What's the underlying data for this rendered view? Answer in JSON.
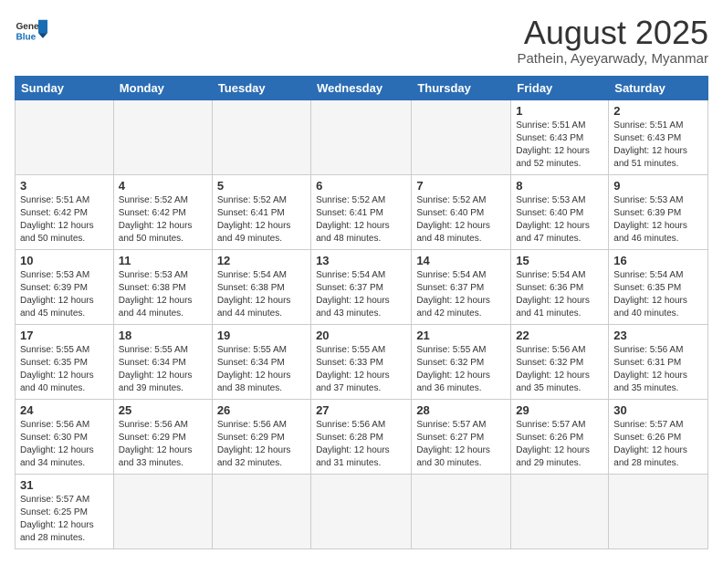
{
  "logo": {
    "text_general": "General",
    "text_blue": "Blue"
  },
  "title": "August 2025",
  "subtitle": "Pathein, Ayeyarwady, Myanmar",
  "weekdays": [
    "Sunday",
    "Monday",
    "Tuesday",
    "Wednesday",
    "Thursday",
    "Friday",
    "Saturday"
  ],
  "weeks": [
    [
      {
        "day": "",
        "info": ""
      },
      {
        "day": "",
        "info": ""
      },
      {
        "day": "",
        "info": ""
      },
      {
        "day": "",
        "info": ""
      },
      {
        "day": "",
        "info": ""
      },
      {
        "day": "1",
        "info": "Sunrise: 5:51 AM\nSunset: 6:43 PM\nDaylight: 12 hours and 52 minutes."
      },
      {
        "day": "2",
        "info": "Sunrise: 5:51 AM\nSunset: 6:43 PM\nDaylight: 12 hours and 51 minutes."
      }
    ],
    [
      {
        "day": "3",
        "info": "Sunrise: 5:51 AM\nSunset: 6:42 PM\nDaylight: 12 hours and 50 minutes."
      },
      {
        "day": "4",
        "info": "Sunrise: 5:52 AM\nSunset: 6:42 PM\nDaylight: 12 hours and 50 minutes."
      },
      {
        "day": "5",
        "info": "Sunrise: 5:52 AM\nSunset: 6:41 PM\nDaylight: 12 hours and 49 minutes."
      },
      {
        "day": "6",
        "info": "Sunrise: 5:52 AM\nSunset: 6:41 PM\nDaylight: 12 hours and 48 minutes."
      },
      {
        "day": "7",
        "info": "Sunrise: 5:52 AM\nSunset: 6:40 PM\nDaylight: 12 hours and 48 minutes."
      },
      {
        "day": "8",
        "info": "Sunrise: 5:53 AM\nSunset: 6:40 PM\nDaylight: 12 hours and 47 minutes."
      },
      {
        "day": "9",
        "info": "Sunrise: 5:53 AM\nSunset: 6:39 PM\nDaylight: 12 hours and 46 minutes."
      }
    ],
    [
      {
        "day": "10",
        "info": "Sunrise: 5:53 AM\nSunset: 6:39 PM\nDaylight: 12 hours and 45 minutes."
      },
      {
        "day": "11",
        "info": "Sunrise: 5:53 AM\nSunset: 6:38 PM\nDaylight: 12 hours and 44 minutes."
      },
      {
        "day": "12",
        "info": "Sunrise: 5:54 AM\nSunset: 6:38 PM\nDaylight: 12 hours and 44 minutes."
      },
      {
        "day": "13",
        "info": "Sunrise: 5:54 AM\nSunset: 6:37 PM\nDaylight: 12 hours and 43 minutes."
      },
      {
        "day": "14",
        "info": "Sunrise: 5:54 AM\nSunset: 6:37 PM\nDaylight: 12 hours and 42 minutes."
      },
      {
        "day": "15",
        "info": "Sunrise: 5:54 AM\nSunset: 6:36 PM\nDaylight: 12 hours and 41 minutes."
      },
      {
        "day": "16",
        "info": "Sunrise: 5:54 AM\nSunset: 6:35 PM\nDaylight: 12 hours and 40 minutes."
      }
    ],
    [
      {
        "day": "17",
        "info": "Sunrise: 5:55 AM\nSunset: 6:35 PM\nDaylight: 12 hours and 40 minutes."
      },
      {
        "day": "18",
        "info": "Sunrise: 5:55 AM\nSunset: 6:34 PM\nDaylight: 12 hours and 39 minutes."
      },
      {
        "day": "19",
        "info": "Sunrise: 5:55 AM\nSunset: 6:34 PM\nDaylight: 12 hours and 38 minutes."
      },
      {
        "day": "20",
        "info": "Sunrise: 5:55 AM\nSunset: 6:33 PM\nDaylight: 12 hours and 37 minutes."
      },
      {
        "day": "21",
        "info": "Sunrise: 5:55 AM\nSunset: 6:32 PM\nDaylight: 12 hours and 36 minutes."
      },
      {
        "day": "22",
        "info": "Sunrise: 5:56 AM\nSunset: 6:32 PM\nDaylight: 12 hours and 35 minutes."
      },
      {
        "day": "23",
        "info": "Sunrise: 5:56 AM\nSunset: 6:31 PM\nDaylight: 12 hours and 35 minutes."
      }
    ],
    [
      {
        "day": "24",
        "info": "Sunrise: 5:56 AM\nSunset: 6:30 PM\nDaylight: 12 hours and 34 minutes."
      },
      {
        "day": "25",
        "info": "Sunrise: 5:56 AM\nSunset: 6:29 PM\nDaylight: 12 hours and 33 minutes."
      },
      {
        "day": "26",
        "info": "Sunrise: 5:56 AM\nSunset: 6:29 PM\nDaylight: 12 hours and 32 minutes."
      },
      {
        "day": "27",
        "info": "Sunrise: 5:56 AM\nSunset: 6:28 PM\nDaylight: 12 hours and 31 minutes."
      },
      {
        "day": "28",
        "info": "Sunrise: 5:57 AM\nSunset: 6:27 PM\nDaylight: 12 hours and 30 minutes."
      },
      {
        "day": "29",
        "info": "Sunrise: 5:57 AM\nSunset: 6:26 PM\nDaylight: 12 hours and 29 minutes."
      },
      {
        "day": "30",
        "info": "Sunrise: 5:57 AM\nSunset: 6:26 PM\nDaylight: 12 hours and 28 minutes."
      }
    ],
    [
      {
        "day": "31",
        "info": "Sunrise: 5:57 AM\nSunset: 6:25 PM\nDaylight: 12 hours and 28 minutes."
      },
      {
        "day": "",
        "info": ""
      },
      {
        "day": "",
        "info": ""
      },
      {
        "day": "",
        "info": ""
      },
      {
        "day": "",
        "info": ""
      },
      {
        "day": "",
        "info": ""
      },
      {
        "day": "",
        "info": ""
      }
    ]
  ]
}
